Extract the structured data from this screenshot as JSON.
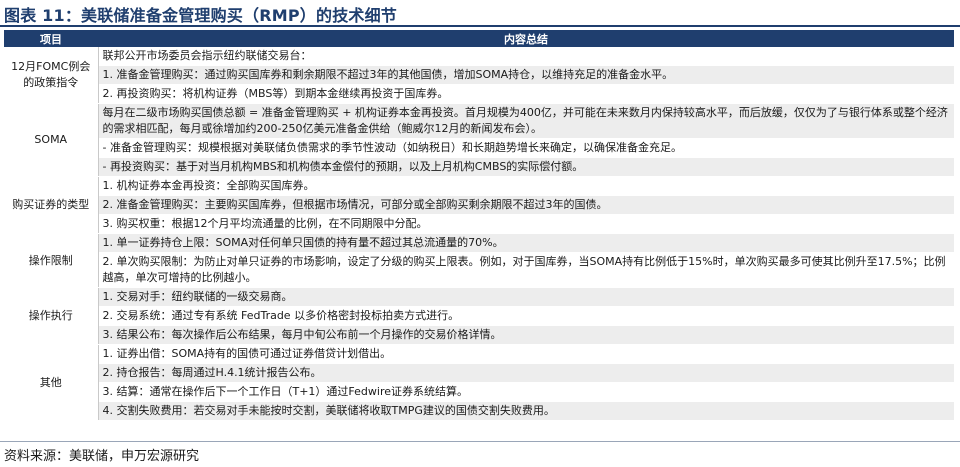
{
  "title": "图表 11：美联储准备金管理购买（RMP）的技术细节",
  "header": {
    "col1": "项目",
    "col2": "内容总结"
  },
  "sections": [
    {
      "label": "12月FOMC例会的政策指令",
      "lines": [
        "联邦公开市场委员会指示纽约联储交易台：",
        "1. 准备金管理购买：通过购买国库券和剩余期限不超过3年的其他国债，增加SOMA持仓，以维持充足的准备金水平。",
        "2. 再投资购买：将机构证券（MBS等）到期本金继续再投资于国库券。"
      ]
    },
    {
      "label": "SOMA",
      "lines": [
        "每月在二级市场购买国债总额 = 准备金管理购买 + 机构证券本金再投资。首月规模为400亿，并可能在未来数月内保持较高水平，而后放缓，仅仅为了与银行体系或整个经济的需求相匹配，每月或徐增加约200-250亿美元准备金供给（鲍威尔12月的新闻发布会）。",
        "- 准备金管理购买：规模根据对美联储负债需求的季节性波动（如纳税日）和长期趋势增长来确定，以确保准备金充足。",
        "- 再投资购买：基于对当月机构MBS和机构债本金偿付的预期，以及上月机构CMBS的实际偿付额。"
      ]
    },
    {
      "label": "购买证券的类型",
      "lines": [
        "1. 机构证券本金再投资：全部购买国库券。",
        "2. 准备金管理购买：主要购买国库券，但根据市场情况，可部分或全部购买剩余期限不超过3年的国债。",
        "3. 购买权重：根据12个月平均流通量的比例，在不同期限中分配。"
      ]
    },
    {
      "label": "操作限制",
      "lines": [
        "1. 单一证券持仓上限：SOMA对任何单只国债的持有量不超过其总流通量的70%。",
        "2. 单次购买限制：为防止对单只证券的市场影响，设定了分级的购买上限表。例如，对于国库券，当SOMA持有比例低于15%时，单次购买最多可使其比例升至17.5%；比例越高，单次可增持的比例越小。"
      ]
    },
    {
      "label": "操作执行",
      "lines": [
        "1. 交易对手：纽约联储的一级交易商。",
        "2. 交易系统：通过专有系统 FedTrade 以多价格密封投标拍卖方式进行。",
        "3. 结果公布：每次操作后公布结果，每月中旬公布前一个月操作的交易价格详情。"
      ]
    },
    {
      "label": "其他",
      "lines": [
        "1. 证券出借：SOMA持有的国债可通过证券借贷计划借出。",
        "2. 持仓报告：每周通过H.4.1统计报告公布。",
        "3. 结算：通常在操作后下一个工作日（T+1）通过Fedwire证券系统结算。",
        "4. 交割失败费用：若交易对手未能按时交割，美联储将收取TMPG建议的国债交割失败费用。"
      ]
    }
  ],
  "source": "资料来源：美联储，申万宏源研究"
}
